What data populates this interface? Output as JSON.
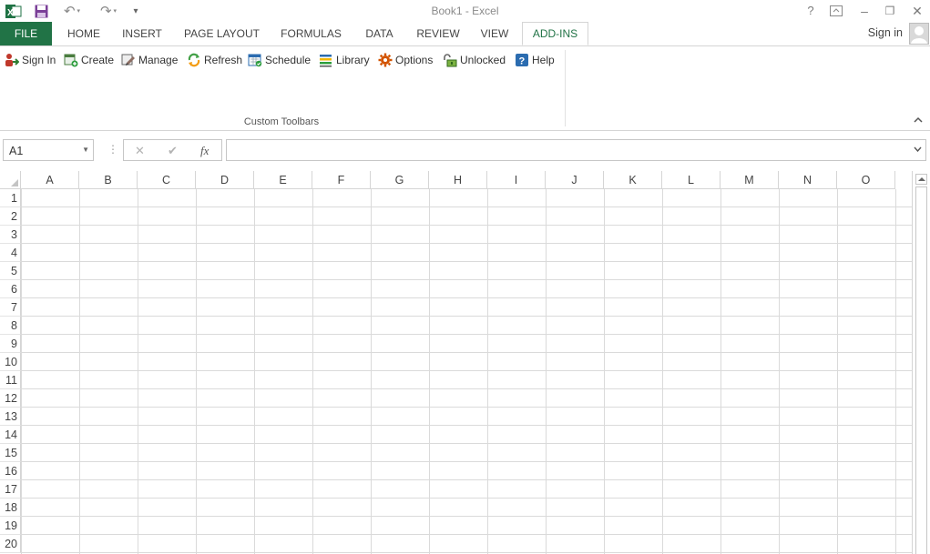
{
  "window": {
    "title": "Book1 - Excel"
  },
  "tabs": [
    {
      "id": "file",
      "label": "FILE"
    },
    {
      "id": "home",
      "label": "HOME"
    },
    {
      "id": "insert",
      "label": "INSERT"
    },
    {
      "id": "page-layout",
      "label": "PAGE LAYOUT"
    },
    {
      "id": "formulas",
      "label": "FORMULAS"
    },
    {
      "id": "data",
      "label": "DATA"
    },
    {
      "id": "review",
      "label": "REVIEW"
    },
    {
      "id": "view",
      "label": "VIEW"
    },
    {
      "id": "add-ins",
      "label": "ADD-INS"
    }
  ],
  "active_tab": "ADD-INS",
  "account": {
    "sign_in": "Sign in"
  },
  "ribbon": {
    "group_label": "Custom Toolbars",
    "buttons": [
      {
        "label": "Sign In",
        "icon": "sign-in-icon"
      },
      {
        "label": "Create",
        "icon": "create-icon"
      },
      {
        "label": "Manage",
        "icon": "manage-icon"
      },
      {
        "label": "Refresh",
        "icon": "refresh-icon"
      },
      {
        "label": "Schedule",
        "icon": "schedule-icon"
      },
      {
        "label": "Library",
        "icon": "library-icon"
      },
      {
        "label": "Options",
        "icon": "options-gear-icon"
      },
      {
        "label": "Unlocked",
        "icon": "unlocked-icon"
      },
      {
        "label": "Help",
        "icon": "help-icon"
      }
    ]
  },
  "formula_bar": {
    "name_box": "A1",
    "fx_label": "fx",
    "formula": ""
  },
  "grid": {
    "columns": [
      "A",
      "B",
      "C",
      "D",
      "E",
      "F",
      "G",
      "H",
      "I",
      "J",
      "K",
      "L",
      "M",
      "N",
      "O"
    ],
    "rows": [
      "1",
      "2",
      "3",
      "4",
      "5",
      "6",
      "7",
      "8",
      "9",
      "10",
      "11",
      "12",
      "13",
      "14",
      "15",
      "16",
      "17",
      "18",
      "19",
      "20"
    ]
  },
  "colors": {
    "accent": "#217346",
    "grid_line": "#dadada",
    "header_border": "#d5d5d5"
  }
}
